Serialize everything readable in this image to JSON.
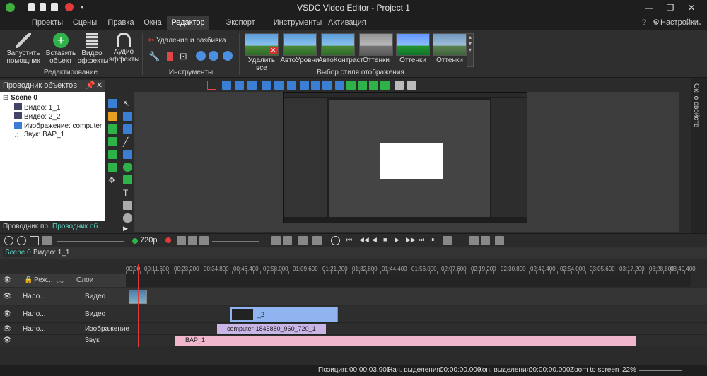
{
  "window": {
    "title": "VSDC Video Editor - Project 1"
  },
  "menubar": {
    "items": [
      "Проекты",
      "Сцены",
      "Правка",
      "Окна",
      "Редактор",
      "Экспорт проекта",
      "Инструменты",
      "Активация"
    ],
    "settings_label": "Настройки"
  },
  "ribbon": {
    "wizard": "Запустить\nпомощник",
    "insert_object": "Вставить\nобъект",
    "video_effects": "Видео\nэффекты",
    "audio_effects": "Аудио\nэффекты",
    "editing_group": "Редактирование",
    "delete_split": "Удаление и разбивка",
    "tools_group": "Инструменты",
    "style_group": "Выбор стиля отображения",
    "styles": [
      "Удалить все",
      "АвтоУровни",
      "АвтоКонтраст",
      "Оттенки",
      "Оттенки",
      "Оттенки"
    ]
  },
  "object_explorer": {
    "title": "Проводник объектов",
    "scene": "Scene 0",
    "items": [
      "Видео: 1_1",
      "Видео: 2_2",
      "Изображение: computer",
      "Звук: BAP_1"
    ],
    "tab1": "Проводник пр...",
    "tab2": "Проводник об..."
  },
  "properties_panel": {
    "title": "Окно свойств"
  },
  "timeline": {
    "resolution": "720p",
    "tabs": [
      "Scene 0",
      "Видео: 1_1"
    ],
    "header_mode": "Реж...",
    "header_layers": "Слои",
    "ruler": [
      "00:00",
      "00:11.600",
      "00:23.200",
      "00:34.800",
      "00:46.400",
      "00:58.000",
      "01:09.600",
      "01:21.200",
      "01:32.800",
      "01:44.400",
      "01:56.000",
      "02:07.600",
      "02:19.200",
      "02:30.800",
      "02:42.400",
      "02:54.000",
      "03:05.600",
      "03:17.200",
      "03:28.800",
      "03:40.400"
    ],
    "tracks": [
      {
        "blend": "Нало...",
        "type": "Видео"
      },
      {
        "blend": "Нало...",
        "type": "Видео"
      },
      {
        "blend": "Нало...",
        "type": "Изображение"
      },
      {
        "blend": "",
        "type": "Звук"
      }
    ],
    "clips": {
      "video2": "_2",
      "image": "computer-1845880_960_720_1",
      "audio": "BAP_1"
    }
  },
  "status": {
    "position_label": "Позиция:",
    "position": "00:00:03.900",
    "sel_start_label": "Нач. выделения:",
    "sel_start": "00:00:00.000",
    "sel_end_label": "Кон. выделения:",
    "sel_end": "00:00:00.000",
    "zoom_label": "Zoom to screen",
    "zoom": "22%"
  },
  "colors": {
    "accent": "#3b7fd4",
    "clip_video": "#8fb4ef",
    "clip_image": "#c9b5e6",
    "clip_audio": "#f0b6cc"
  }
}
